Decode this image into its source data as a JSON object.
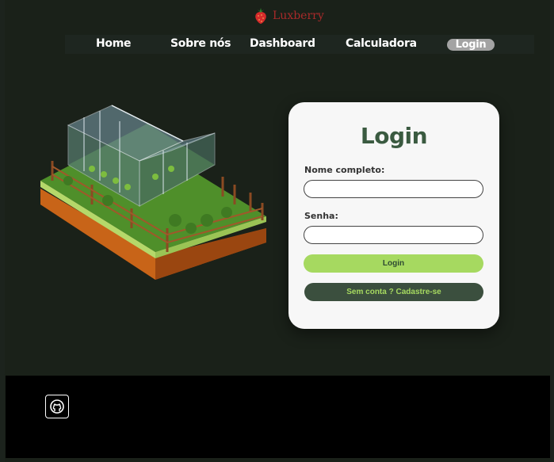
{
  "brand": {
    "name": "Luxberry",
    "icon": "strawberry-icon"
  },
  "nav": {
    "items": [
      {
        "label": "Home"
      },
      {
        "label": "Sobre nós"
      },
      {
        "label": "Dashboard"
      },
      {
        "label": "Calculadora"
      }
    ],
    "login_label": "Login"
  },
  "illustration": {
    "icon": "greenhouse-illustration"
  },
  "login_card": {
    "title": "Login",
    "name_label": "Nome completo:",
    "name_value": "",
    "password_label": "Senha:",
    "password_value": "",
    "submit_label": "Login",
    "register_label": "Sem conta ? Cadastre-se"
  },
  "footer": {
    "icon": "github-icon"
  },
  "colors": {
    "background": "#1a2119",
    "brand": "#a82a2a",
    "title": "#3a5a40",
    "accent": "#a6d960",
    "dark_button": "#3b4f3e"
  }
}
